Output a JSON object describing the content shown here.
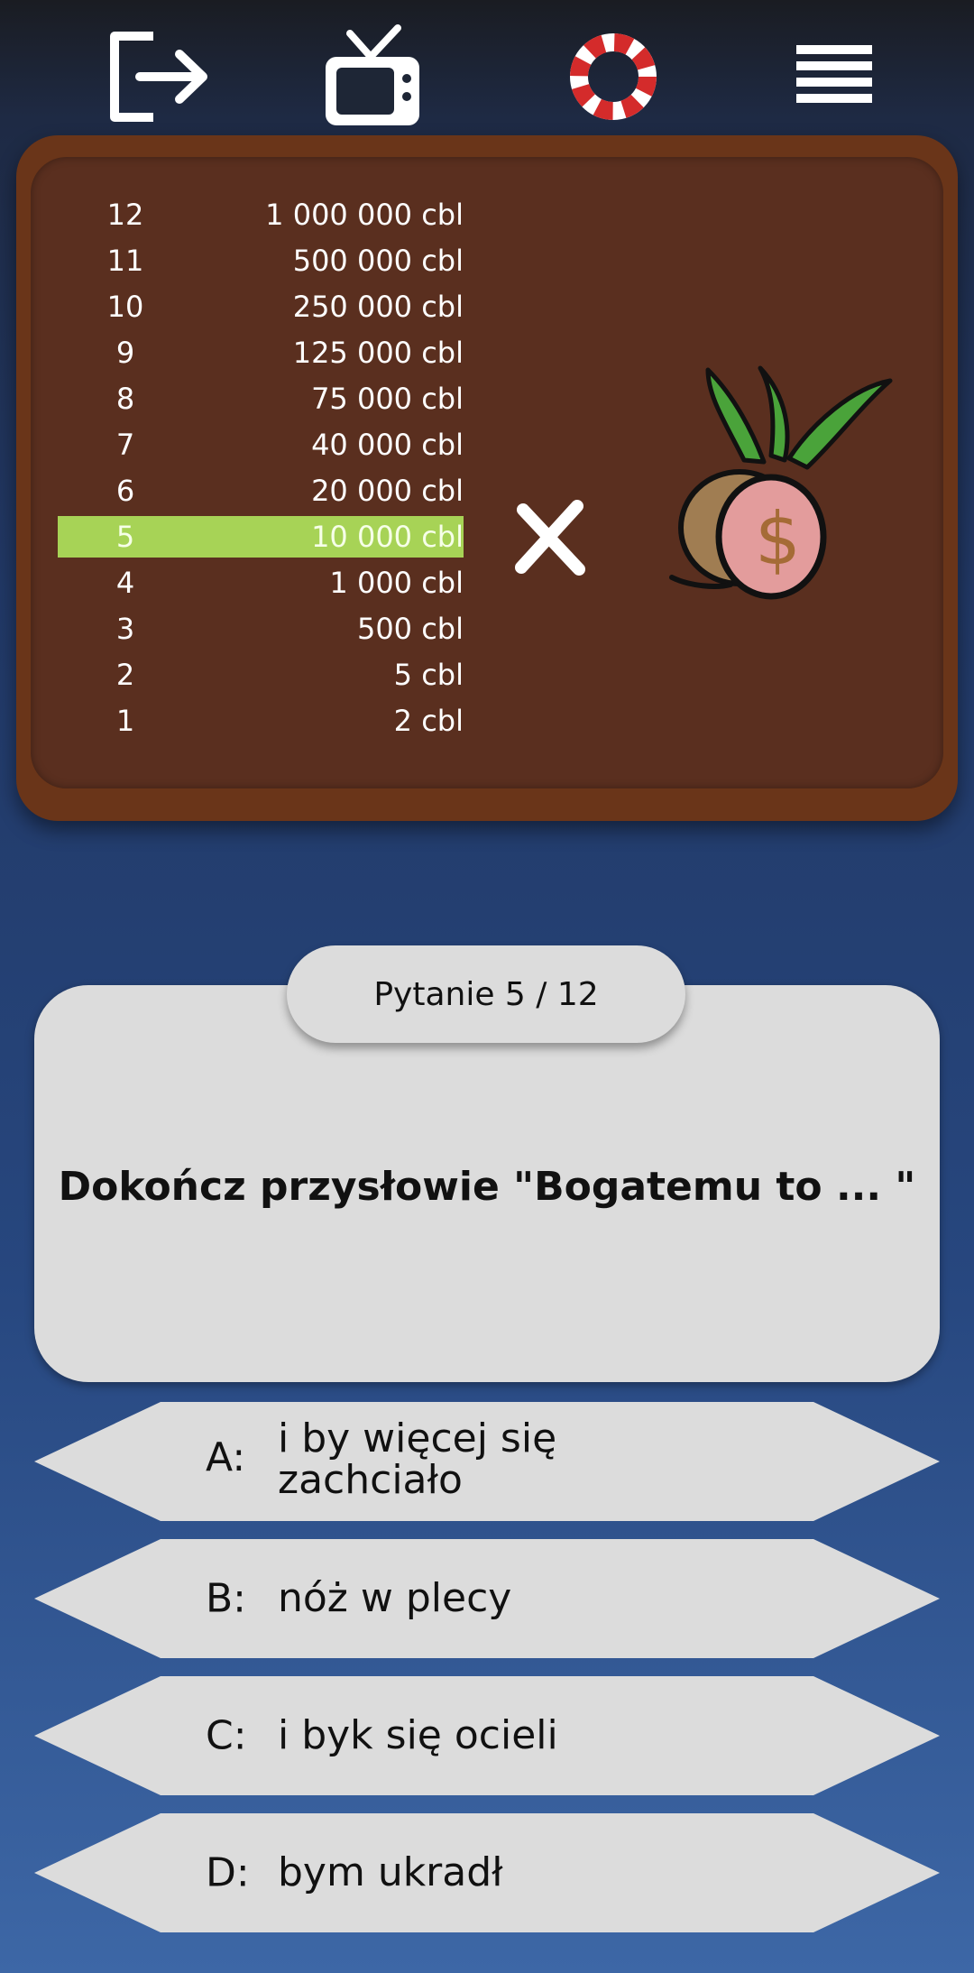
{
  "topbar": {
    "icons": [
      "exit-icon",
      "tv-icon",
      "lifebuoy-icon",
      "menu-icon"
    ]
  },
  "ladder": [
    {
      "level": "12",
      "amount": "1 000 000 cbl"
    },
    {
      "level": "11",
      "amount": "500 000 cbl"
    },
    {
      "level": "10",
      "amount": "250 000 cbl"
    },
    {
      "level": "9",
      "amount": "125 000 cbl"
    },
    {
      "level": "8",
      "amount": "75 000 cbl"
    },
    {
      "level": "7",
      "amount": "40 000 cbl"
    },
    {
      "level": "6",
      "amount": "20 000 cbl"
    },
    {
      "level": "5",
      "amount": "10 000 cbl"
    },
    {
      "level": "4",
      "amount": "1 000 cbl"
    },
    {
      "level": "3",
      "amount": "500 cbl"
    },
    {
      "level": "2",
      "amount": "5 cbl"
    },
    {
      "level": "1",
      "amount": "2 cbl"
    }
  ],
  "current_level": "5",
  "colors": {
    "highlight": "#a7d356",
    "board": "#5a2f1f",
    "card": "#dcdcdc"
  },
  "question": {
    "counter": "Pytanie 5 / 12",
    "text": "Dokończ przysłowie \"Bogatemu to ... \""
  },
  "answers": [
    {
      "letter": "A:",
      "text": "i by więcej się zachciało"
    },
    {
      "letter": "B:",
      "text": "nóż w plecy"
    },
    {
      "letter": "C:",
      "text": "i byk się ocieli"
    },
    {
      "letter": "D:",
      "text": "bym ukradł"
    }
  ]
}
